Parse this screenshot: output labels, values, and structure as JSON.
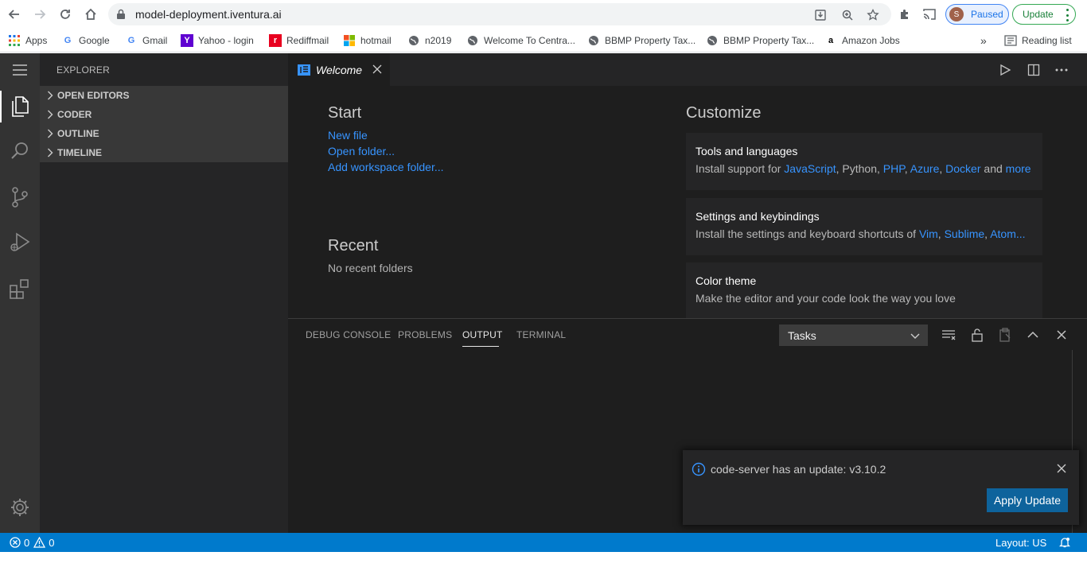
{
  "browser": {
    "url": "model-deployment.iventura.ai",
    "profile": {
      "initial": "S",
      "label": "Paused"
    },
    "update_label": "Update",
    "bookmarks": [
      {
        "label": "Apps",
        "icon": "apps-grid-icon"
      },
      {
        "label": "Google",
        "icon": "google-icon"
      },
      {
        "label": "Gmail",
        "icon": "google-icon"
      },
      {
        "label": "Yahoo - login",
        "icon": "yahoo-icon"
      },
      {
        "label": "Rediffmail",
        "icon": "rediff-icon"
      },
      {
        "label": "hotmail",
        "icon": "microsoft-icon"
      },
      {
        "label": "n2019",
        "icon": "globe-icon"
      },
      {
        "label": "Welcome To Centra...",
        "icon": "globe-icon"
      },
      {
        "label": "BBMP Property Tax...",
        "icon": "globe-icon"
      },
      {
        "label": "BBMP Property Tax...",
        "icon": "globe-icon"
      },
      {
        "label": "Amazon Jobs",
        "icon": "amazon-icon"
      }
    ],
    "more_bookmarks": "»",
    "reading_list": "Reading list"
  },
  "sidebar": {
    "title": "EXPLORER",
    "sections": [
      "OPEN EDITORS",
      "CODER",
      "OUTLINE",
      "TIMELINE"
    ]
  },
  "tab": {
    "label": "Welcome"
  },
  "welcome": {
    "start": {
      "heading": "Start",
      "links": [
        "New file",
        "Open folder...",
        "Add workspace folder..."
      ]
    },
    "recent": {
      "heading": "Recent",
      "empty": "No recent folders"
    },
    "customize": {
      "heading": "Customize",
      "cards": [
        {
          "title": "Tools and languages",
          "prefix": "Install support for ",
          "links": [
            "JavaScript",
            "Python",
            "PHP",
            "Azure",
            "Docker"
          ],
          "and": " and ",
          "more": "more"
        },
        {
          "title": "Settings and keybindings",
          "prefix": "Install the settings and keyboard shortcuts of ",
          "links": [
            "Vim",
            "Sublime",
            "Atom..."
          ]
        },
        {
          "title": "Color theme",
          "desc": "Make the editor and your code look the way you love"
        }
      ]
    }
  },
  "panel": {
    "tabs": [
      "DEBUG CONSOLE",
      "PROBLEMS",
      "OUTPUT",
      "TERMINAL"
    ],
    "active_tab": "OUTPUT",
    "select_value": "Tasks"
  },
  "notification": {
    "message": "code-server has an update: v3.10.2",
    "button": "Apply Update"
  },
  "statusbar": {
    "errors": "0",
    "warnings": "0",
    "layout": "Layout: US"
  },
  "colors": {
    "accent": "#007acc",
    "link": "#3794ff",
    "button": "#0e639c"
  }
}
